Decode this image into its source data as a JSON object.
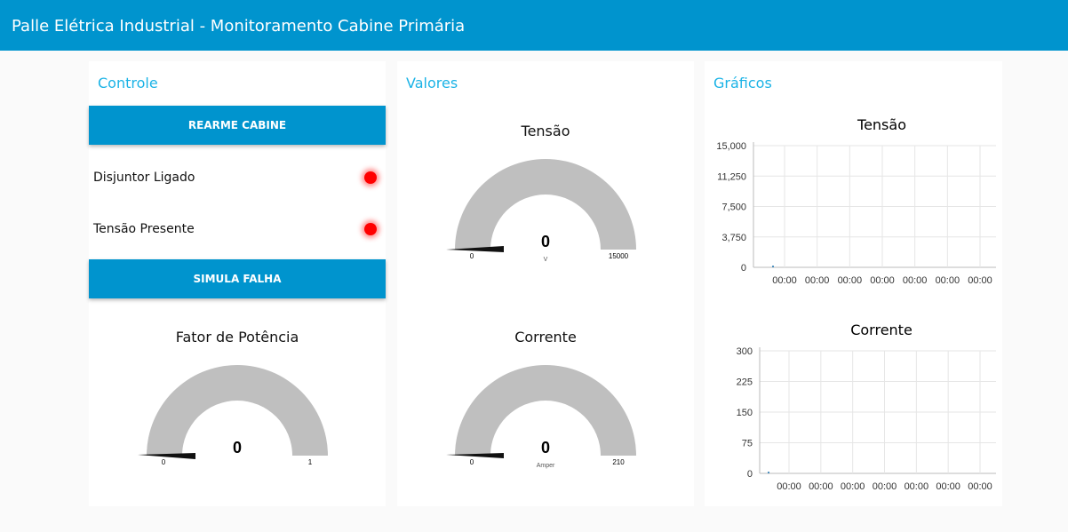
{
  "header": {
    "title": "Palle Elétrica Industrial - Monitoramento Cabine Primária"
  },
  "colors": {
    "accent": "#0094ce",
    "title": "#1bb3e6",
    "gauge_track": "#bfbfbf",
    "led_on": "#ff0000"
  },
  "controle": {
    "title": "Controle",
    "rearme_label": "REARME CABINE",
    "simula_label": "SIMULA FALHA",
    "disjuntor_label": "Disjuntor Ligado",
    "tensao_label": "Tensão Presente",
    "disjuntor_state": "on",
    "tensao_state": "on"
  },
  "valores": {
    "title": "Valores"
  },
  "graficos": {
    "title": "Gráficos"
  },
  "gauges": {
    "fator": {
      "title": "Fator de Potência",
      "value": "0",
      "min": "0",
      "max": "1",
      "unit": ""
    },
    "tensao": {
      "title": "Tensão",
      "value": "0",
      "min": "0",
      "max": "15000",
      "unit": "V"
    },
    "corrente": {
      "title": "Corrente",
      "value": "0",
      "min": "0",
      "max": "210",
      "unit": "Amper"
    }
  },
  "chart_data": [
    {
      "type": "line",
      "title": "Tensão",
      "xlabel": "",
      "ylabel": "",
      "x": [
        "00:00",
        "00:00",
        "00:00",
        "00:00",
        "00:00",
        "00:00",
        "00:00"
      ],
      "yticks": [
        "0",
        "3,750",
        "7,500",
        "11,250",
        "15,000"
      ],
      "ylim": [
        0,
        15000
      ],
      "series": [
        {
          "values": [
            0
          ]
        }
      ],
      "grid": true
    },
    {
      "type": "line",
      "title": "Corrente",
      "xlabel": "",
      "ylabel": "",
      "x": [
        "00:00",
        "00:00",
        "00:00",
        "00:00",
        "00:00",
        "00:00",
        "00:00"
      ],
      "yticks": [
        "0",
        "75",
        "150",
        "225",
        "300"
      ],
      "ylim": [
        0,
        300
      ],
      "series": [
        {
          "values": [
            0
          ]
        }
      ],
      "grid": true
    }
  ]
}
